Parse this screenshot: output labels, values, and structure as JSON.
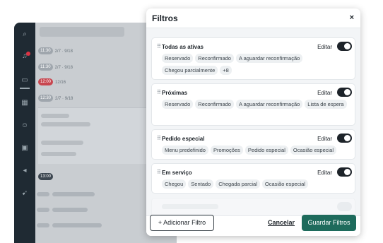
{
  "modal": {
    "title": "Filtros",
    "close_label": "×"
  },
  "filters": [
    {
      "name": "Todas as ativas",
      "edit_label": "Editar",
      "enabled": true,
      "chips": [
        "Reservado",
        "Reconfirmado",
        "A aguardar reconfirmação",
        "Chegou parcialmente",
        "+8"
      ]
    },
    {
      "name": "Próximas",
      "edit_label": "Editar",
      "enabled": true,
      "chips": [
        "Reservado",
        "Reconfirmado",
        "A aguardar reconfirmação",
        "Lista de espera"
      ]
    },
    {
      "name": "Pedido especial",
      "edit_label": "Editar",
      "enabled": true,
      "chips": [
        "Menu predefinido",
        "Promoções",
        "Pedido especial",
        "Ocasião especial"
      ]
    },
    {
      "name": "Em serviço",
      "edit_label": "Editar",
      "enabled": true,
      "chips": [
        "Chegou",
        "Sentado",
        "Chegada parcial",
        "Ocasião especial"
      ]
    }
  ],
  "footer": {
    "add_label": "+ Adicionar Filtro",
    "cancel_label": "Cancelar",
    "save_label": "Guardar Filtros"
  },
  "background": {
    "times": [
      "11:30",
      "11:30",
      "12:00",
      "12:30",
      "13:00"
    ],
    "row_meta": [
      "2/7",
      "9/18",
      "2/7",
      "9/18",
      "12/16",
      "2/7",
      "9/18"
    ]
  },
  "colors": {
    "primary": "#1e6b5c",
    "dark": "#1d2329",
    "rail": "#1f2a33",
    "late_badge": "#c8464f"
  }
}
